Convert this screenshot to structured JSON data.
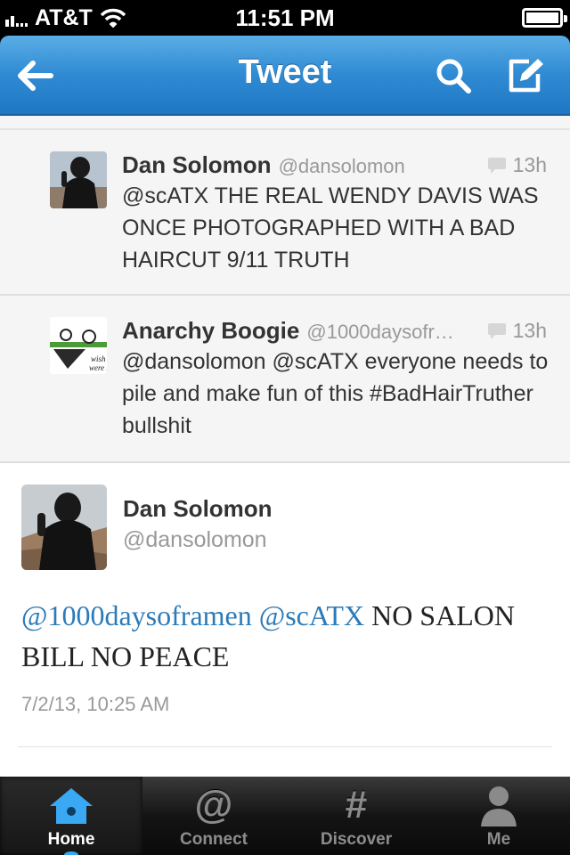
{
  "status_bar": {
    "carrier": "AT&T",
    "time": "11:51 PM"
  },
  "navbar": {
    "title": "Tweet",
    "icons": [
      "back-arrow-icon",
      "search-icon",
      "compose-icon"
    ]
  },
  "replies": [
    {
      "name": "Dan Solomon",
      "handle": "@dansolomon",
      "time": "13h",
      "text": "@scATX THE REAL WENDY DAVIS WAS ONCE PHOTOGRAPHED WITH A BAD HAIRCUT 9/11 TRUTH"
    },
    {
      "name": "Anarchy Boogie",
      "handle": "@1000daysofr…",
      "time": "13h",
      "avatar_text": [
        "wish you",
        "were here"
      ],
      "text": "@dansolomon @scATX everyone needs to pile and make fun of this #BadHairTruther bullshit"
    }
  ],
  "main_tweet": {
    "name": "Dan Solomon",
    "handle": "@dansolomon",
    "mention1": "@1000daysoframen",
    "mention2": "@scATX",
    "text_rest": "NO SALON BILL NO PEACE",
    "timestamp": "7/2/13, 10:25 AM"
  },
  "tabbar": {
    "items": [
      {
        "label": "Home",
        "icon": "home-icon",
        "active": true
      },
      {
        "label": "Connect",
        "icon": "at-icon",
        "glyph": "@"
      },
      {
        "label": "Discover",
        "icon": "hash-icon",
        "glyph": "#"
      },
      {
        "label": "Me",
        "icon": "person-icon"
      }
    ]
  },
  "colors": {
    "nav_blue": "#2f8ad3",
    "mention_blue": "#2b7bb9",
    "tab_active": "#38a7f2"
  }
}
